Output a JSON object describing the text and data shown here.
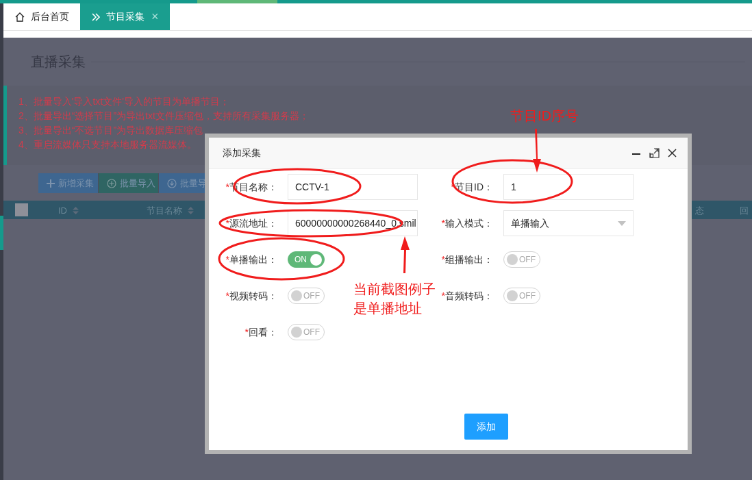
{
  "tabs": [
    {
      "label": "后台首页",
      "selected": false,
      "closable": false
    },
    {
      "label": "节目采集",
      "selected": true,
      "closable": true,
      "close": "×"
    }
  ],
  "page": {
    "title": "直播采集",
    "notes": [
      "1、批量导入'导入txt文件'导入的节目为单播节目；",
      "2、批量导出“选择节目”为导出txt文件压缩包，支持所有采集服务器；",
      "3、批量导出“不选节目”为导出数据库压缩包",
      "4、重启流媒体只支持本地服务器流媒体。"
    ],
    "toolbar": [
      {
        "label": "新增采集",
        "kind": "add"
      },
      {
        "label": "批量导入",
        "kind": "import"
      },
      {
        "label": "批量导",
        "kind": "export"
      }
    ],
    "table": {
      "header_checkbox": {
        "checked": false
      },
      "columns": [
        {
          "label": "ID",
          "sortable": true
        },
        {
          "label": "节目名称",
          "sortable": true
        },
        {
          "label": "态",
          "sortable": false
        },
        {
          "label": "回",
          "sortable": false
        }
      ]
    }
  },
  "dialog": {
    "title": "添加采集",
    "fields": [
      {
        "mark": "*",
        "label": "节目名称：",
        "kind": "text",
        "value": "CCTV-1"
      },
      {
        "mark": "*",
        "label": "节目ID：",
        "kind": "text",
        "value": "1"
      },
      {
        "mark": "*",
        "label": "源流地址：",
        "kind": "text",
        "value": "60000000000268440_0.smil"
      },
      {
        "mark": "*",
        "label": "输入模式：",
        "kind": "select",
        "value": "单播输入"
      },
      {
        "mark": "*",
        "label": "单播输出：",
        "kind": "toggle",
        "on": true,
        "state_text": "ON"
      },
      {
        "mark": "*",
        "label": "组播输出：",
        "kind": "toggle",
        "on": false,
        "state_text": "OFF"
      },
      {
        "mark": "*",
        "label": "视频转码：",
        "kind": "toggle",
        "on": false,
        "state_text": "OFF"
      },
      {
        "mark": "*",
        "label": "音频转码：",
        "kind": "toggle",
        "on": false,
        "state_text": "OFF"
      },
      {
        "mark": "*",
        "label": "回看：",
        "kind": "toggle",
        "on": false,
        "state_text": "OFF"
      }
    ],
    "submit": "添加"
  },
  "annotations": [
    {
      "text": "节目ID序号"
    },
    {
      "text": "当前截图例子"
    },
    {
      "text": "是单播地址"
    }
  ]
}
